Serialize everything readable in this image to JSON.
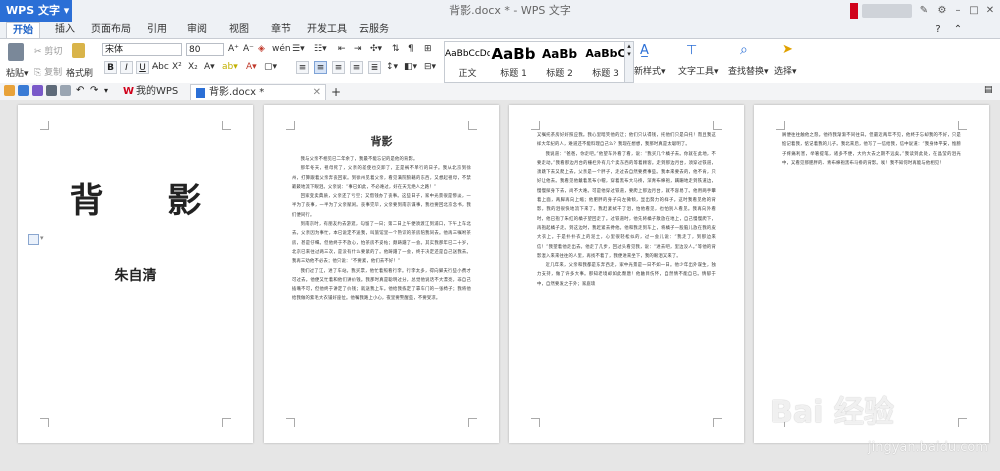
{
  "app": {
    "logo": "WPS 文字",
    "window_title": "背影.docx * - WPS 文字"
  },
  "menu": {
    "items": [
      {
        "label": "开始",
        "active": true
      },
      {
        "label": "插入"
      },
      {
        "label": "页面布局"
      },
      {
        "label": "引用"
      },
      {
        "label": "审阅"
      },
      {
        "label": "视图"
      },
      {
        "label": "章节"
      },
      {
        "label": "开发工具"
      },
      {
        "label": "云服务"
      }
    ]
  },
  "ribbon": {
    "paste": "粘贴",
    "cut": "剪切",
    "copy": "复制",
    "format_painter": "格式刷",
    "font_name": "宋体",
    "font_size": "80",
    "styles": [
      {
        "preview": "AaBbCcDd",
        "label": "正文"
      },
      {
        "preview": "AaBb",
        "label": "标题 1"
      },
      {
        "preview": "AaBb",
        "label": "标题 2"
      },
      {
        "preview": "AaBbC",
        "label": "标题 3"
      }
    ],
    "new_style": "新样式",
    "text_tools": "文字工具",
    "find_replace": "查找替换",
    "select": "选择"
  },
  "tabs": [
    {
      "label": "我的WPS"
    },
    {
      "label": "背影.docx *",
      "active": true
    }
  ],
  "cover": {
    "title": "背  影",
    "author": "朱自清"
  },
  "page2": {
    "heading": "背影",
    "paras": [
      "我与父亲不相见已二年余了，我最不能忘记的是他的背影。",
      "那年冬天，祖母死了，父亲的差使也交卸了，正是祸不单行的日子。我从北京到徐州，打算跟着父亲奔丧回家。到徐州见着父亲，看见满院狼藉的东西，又想起祖母，不禁簌簌地流下眼泪。父亲说：“事已如此，不必难过，好在天无绝人之路！”",
      "回家变卖典质，父亲还了亏空；又借钱办了丧事。这些日子，家中光景很是惨淡，一半为了丧事，一半为了父亲赋闲。丧事完毕，父亲要到南京谋事，我也要回北京念书，我们便同行。",
      "到南京时，有朋友约去游逛，勾留了一日；第二日上午便须渡江到浦口，下午上车北去。父亲因为事忙，本已说定不送我，叫旅馆里一个熟识的茶房陪我同去。他再三嘱咐茶房，甚是仔细。但他终于不放心，怕茶房不妥帖；颇踌躇了一会。其实我那年已二十岁，北京已来往过两三次，是没有什么要紧的了。他踌躇了一会，终于决定还是自己送我去。我再三劝他不必去；他只说：“不要紧，他们去不好！”",
      "我们过了江，进了车站。我买票，他忙着照看行李。行李太多，得向脚夫行些小费才可过去。他便又忙着和他们讲价钱。我那时真是聪明过分，总觉他说话不大漂亮，非自己插嘴不可，但他终于讲定了价钱；就送我上车。他给我拣定了靠车门的一张椅子；我将他给我做的紫毛大衣铺好座位。他嘱我路上小心，夜里要警醒些，不要受凉。"
    ]
  },
  "page3": {
    "paras": [
      "又嘱托茶房好好照应我。我心里暗笑他的迂；他们只认得钱，托他们只是白托！而且我这样大年纪的人，难道还不能料理自己么？我现在想想，我那时真是太聪明了。",
      "我说道：“爸爸，你走吧。”他望车外看了看，说：“我买几个橘子去。你就在此地，不要走动。”我看那边月台的栅栏外有几个卖东西的等着顾客。走到那边月台，须穿过铁道，须跳下去又爬上去。父亲是一个胖子，走过去自然要费事些。我本来要去的，他不肯，只好让他去。我看见他戴着黑布小帽，穿着黑布大马褂，深青布棉袍，蹒跚地走到铁道边，慢慢探身下去，尚不大难。可是他穿过铁道，要爬上那边月台，就不容易了。他用两手攀着上面，两脚再向上缩；他肥胖的身子向左微倾，显出努力的样子。这时我看见他的背影，我的泪很快地流下来了。我赶紧拭干了泪，怕他看见，也怕别人看见。我再向外看时，他已抱了朱红的橘子望回走了。过铁道时，他先将橘子散放在地上，自己慢慢爬下，再抱起橘子走。到这边时，我赶紧去搀他。他和我走到车上，将橘子一股脑儿放在我的皮大衣上。于是扑扑衣上的泥土，心里很轻松似的，过一会儿说：“我走了，到那边来信！”我望着他走出去。他走了几步，回过头看见我，说：“进去吧，里边没人。”等他的背影混入来来往往的人里，再找不着了，我便进来坐下，我的眼泪又来了。",
      "近几年来，父亲和我都是东奔西走，家中光景是一日不如一日。他少年出外谋生，独力支持，做了许多大事。那知老境却如此颓唐！他触目伤怀，自然情不能自已。情郁于中，自然要发之于外；家庭琐"
    ]
  },
  "page4": {
    "paras": [
      "屑便往往触他之怒。他待我渐渐不同往日。但最近两年不见，他终于忘却我的不好，只是惦记着我，惦记着我的儿子。我北来后，他写了一信给我，信中说道：“我身体平安，惟膀子疼痛利害，举箸提笔，诸多不便，大约大去之期不远矣。”我读到此处，在晶莹的泪光中，又看见那肥胖的、青布棉袍黑布马褂的背影。唉！我不知何时再能与他相见！"
    ]
  },
  "watermark": {
    "text": "Bai 经验",
    "url": "jingyan.baidu.com"
  }
}
